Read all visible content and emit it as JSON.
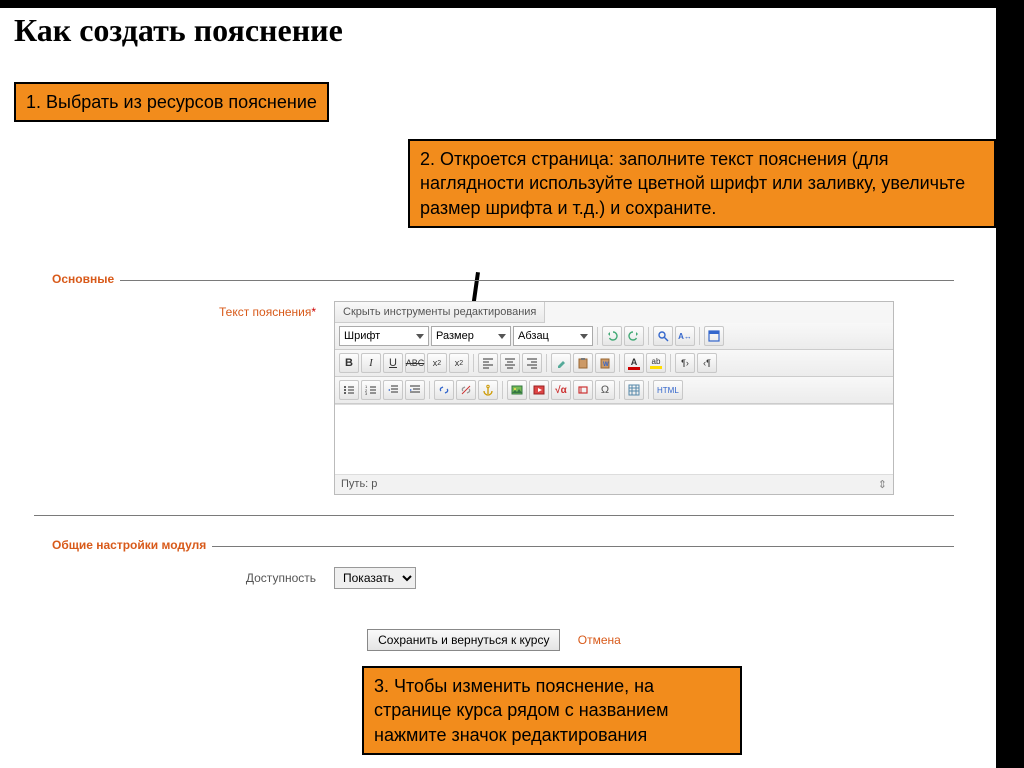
{
  "title": "Как создать пояснение",
  "callouts": {
    "c1": "1. Выбрать из ресурсов пояснение",
    "c2": "2. Откроется страница: заполните текст пояснения (для наглядности используйте цветной шрифт или заливку, увеличьте размер шрифта и т.д.) и сохраните.",
    "c3": "3. Чтобы изменить пояснение, на странице курса рядом с названием нажмите значок редактирования"
  },
  "form": {
    "fieldset1_legend": "Основные",
    "label_text": "Текст пояснения",
    "required_mark": "*",
    "editor": {
      "hide_tools": "Скрыть инструменты редактирования",
      "font_select": "Шрифт",
      "size_select": "Размер",
      "format_select": "Абзац",
      "path_label": "Путь: p",
      "html_btn": "HTML"
    },
    "fieldset2_legend": "Общие настройки модуля",
    "label_visibility": "Доступность",
    "visibility_value": "Показать",
    "save_btn": "Сохранить и вернуться к курсу",
    "cancel_link": "Отмена"
  }
}
